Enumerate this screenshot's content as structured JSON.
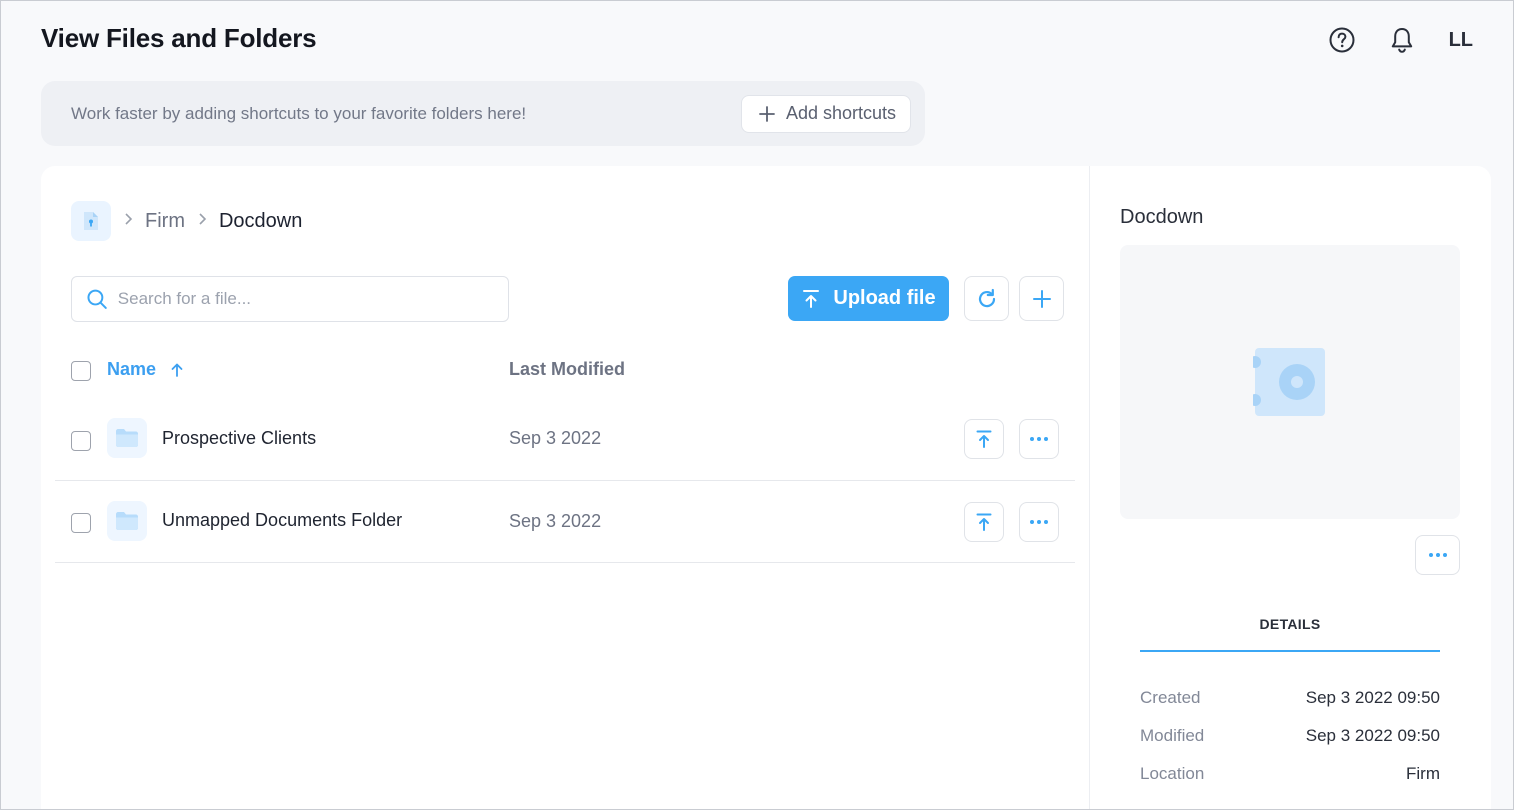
{
  "header": {
    "title": "View Files and Folders",
    "help_icon": "help-circle-icon",
    "notifications_icon": "bell-icon",
    "user_initials": "LL"
  },
  "shortcuts": {
    "message": "Work faster by adding shortcuts to your favorite folders here!",
    "add_label": "Add shortcuts"
  },
  "breadcrumb": {
    "home_icon": "document-lock-icon",
    "items": [
      "Firm",
      "Docdown"
    ]
  },
  "toolbar": {
    "search_placeholder": "Search for a file...",
    "search_value": "",
    "upload_label": "Upload file",
    "refresh_icon": "refresh-icon",
    "add_icon": "plus-icon"
  },
  "table": {
    "columns": {
      "name": "Name",
      "sort": "ascending",
      "modified": "Last Modified"
    },
    "rows": [
      {
        "name": "Prospective Clients",
        "modified": "Sep 3 2022",
        "icon": "folder-icon"
      },
      {
        "name": "Unmapped Documents Folder",
        "modified": "Sep 3 2022",
        "icon": "folder-icon"
      }
    ]
  },
  "details_panel": {
    "title": "Docdown",
    "tab": "DETAILS",
    "fields": [
      {
        "label": "Created",
        "value": "Sep 3 2022 09:50"
      },
      {
        "label": "Modified",
        "value": "Sep 3 2022 09:50"
      },
      {
        "label": "Location",
        "value": "Firm"
      }
    ]
  },
  "colors": {
    "accent": "#3ba7f5",
    "page_background": "#f8f9fb",
    "folder_icon": "#b7dcfb"
  }
}
